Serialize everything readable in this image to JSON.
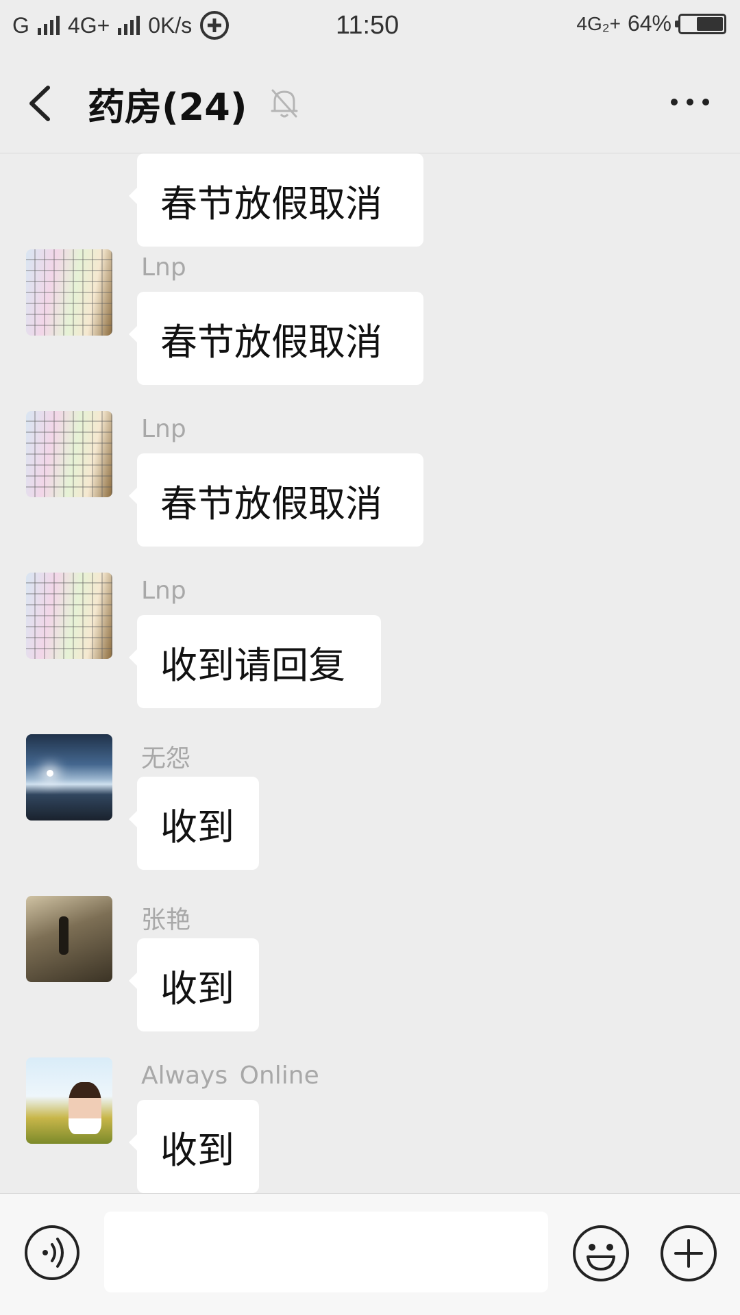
{
  "status_bar": {
    "network": "G",
    "network2": "4G+",
    "speed": "0K/s",
    "time": "11:50",
    "network3": "4G₂+",
    "battery": "64%",
    "battery_level": 0.64
  },
  "header": {
    "title": "药房(24)",
    "back_icon": "chevron-left-icon",
    "mute_icon": "bell-off-icon",
    "more_icon": "more-horizontal-icon"
  },
  "messages": [
    {
      "sender": "",
      "text": "春节放假取消",
      "avatar": "keyboard"
    },
    {
      "sender": "Lnp",
      "text": "春节放假取消",
      "avatar": "keyboard"
    },
    {
      "sender": "Lnp",
      "text": "春节放假取消",
      "avatar": "keyboard"
    },
    {
      "sender": "Lnp",
      "text": "收到请回复",
      "avatar": "keyboard"
    },
    {
      "sender": "无怨",
      "text": "收到",
      "avatar": "sky"
    },
    {
      "sender": "张艳",
      "text": "收到",
      "avatar": "road"
    },
    {
      "sender": "Always  Online",
      "text": "收到",
      "avatar": "woman"
    }
  ],
  "input_bar": {
    "voice_icon": "voice-icon",
    "input_value": "",
    "emoji_icon": "emoji-icon",
    "plus_icon": "plus-circle-icon"
  },
  "colors": {
    "background": "#ededed",
    "bubble": "#ffffff",
    "sender_text": "#a8a8a8"
  }
}
